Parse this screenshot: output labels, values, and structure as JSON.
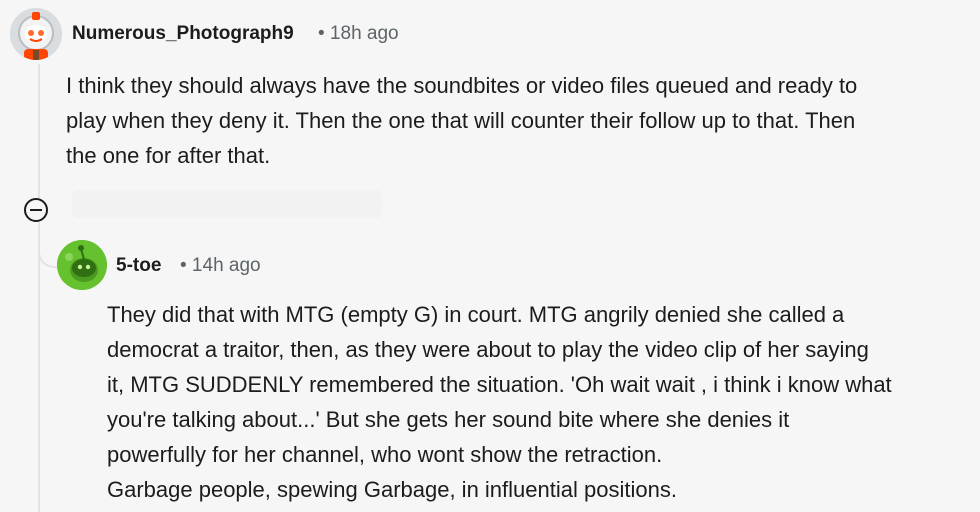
{
  "comments": [
    {
      "username": "Numerous_Photograph9",
      "meta": "• 18h ago",
      "avatar_icon": "reddit-snoo-astronaut-avatar",
      "body_lines": [
        "I think they should always have the soundbites or video files queued and ready to",
        "play when they deny it. Then the one that will counter their follow up to that. Then",
        "the one for after that."
      ]
    },
    {
      "username": "5-toe",
      "meta": "• 14h ago",
      "avatar_icon": "reddit-snoo-green-avatar",
      "body_lines": [
        "They did that with MTG (empty G) in court. MTG angrily denied she called a",
        "democrat a traitor, then, as they were about to play the video clip of her saying",
        "it, MTG SUDDENLY remembered the situation. 'Oh wait wait , i think i know what",
        "you're talking about...' But she gets her sound bite where she denies it",
        "powerfully for her channel, who wont show the retraction.",
        "Garbage people, spewing Garbage, in influential positions."
      ]
    }
  ],
  "colors": {
    "background": "#f6f6f6",
    "thread_line": "#e3e3e3",
    "meta_text": "#5d6468",
    "avatar_green": "#65c22e"
  }
}
